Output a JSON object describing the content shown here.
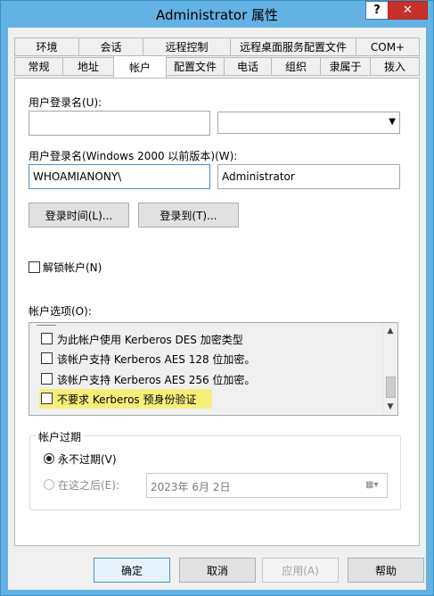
{
  "window": {
    "title": "Administrator 属性",
    "help_label": "?",
    "close_label": "✕"
  },
  "tabs_row1": [
    {
      "label": "环境"
    },
    {
      "label": "会话"
    },
    {
      "label": "远程控制"
    },
    {
      "label": "远程桌面服务配置文件"
    },
    {
      "label": "COM+"
    }
  ],
  "tabs_row2": [
    {
      "label": "常规"
    },
    {
      "label": "地址"
    },
    {
      "label": "帐户",
      "active": true
    },
    {
      "label": "配置文件"
    },
    {
      "label": "电话"
    },
    {
      "label": "组织"
    },
    {
      "label": "隶属于"
    },
    {
      "label": "拨入"
    }
  ],
  "account": {
    "logon_name_label": "用户登录名(U):",
    "logon_name_value": "",
    "upn_suffix_value": "",
    "pre2000_label": "用户登录名(Windows 2000 以前版本)(W):",
    "domain_prefix": "WHOAMIANONY\\",
    "pre2000_name": "Administrator",
    "logon_hours_button": "登录时间(L)...",
    "logon_to_button": "登录到(T)...",
    "unlock_label": "解锁帐户(N)",
    "options_label": "帐户选项(O):",
    "options": [
      {
        "label": "为此帐户使用 Kerberos DES 加密类型",
        "checked": false
      },
      {
        "label": "该帐户支持 Kerberos AES 128 位加密。",
        "checked": false
      },
      {
        "label": "该帐户支持 Kerberos AES 256 位加密。",
        "checked": false
      },
      {
        "label": "不要求 Kerberos 预身份验证",
        "checked": false,
        "highlighted": true
      }
    ],
    "expires": {
      "group_label": "帐户过期",
      "never_label": "永不过期(V)",
      "never_selected": true,
      "end_of_label": "在这之后(E):",
      "end_of_date": "2023年  6月  2日"
    }
  },
  "buttons": {
    "ok": "确定",
    "cancel": "取消",
    "apply": "应用(A)",
    "help": "帮助"
  }
}
